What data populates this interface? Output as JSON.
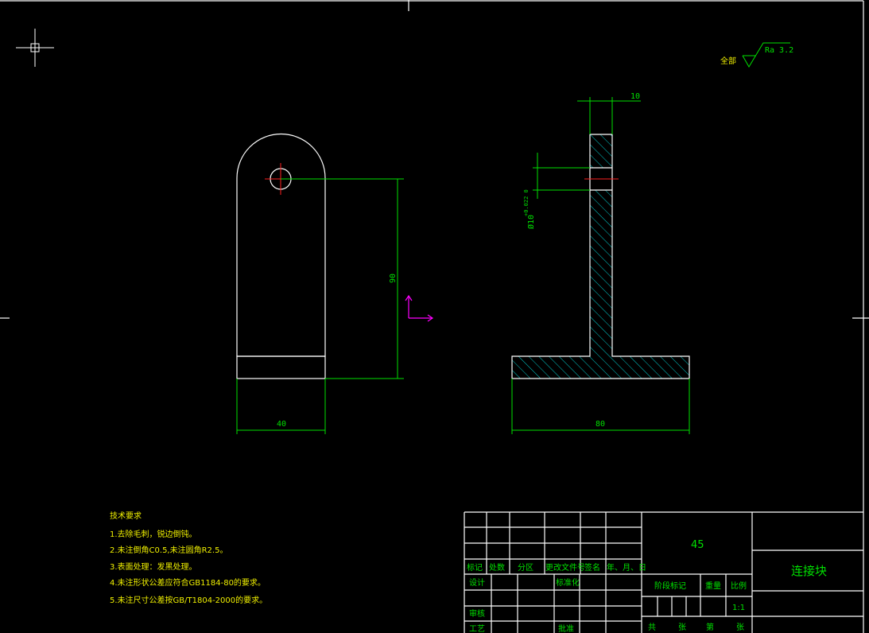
{
  "surface_finish": {
    "prefix": "全部",
    "value": "Ra 3.2"
  },
  "dimensions": {
    "front_width": "40",
    "front_height": "90",
    "side_width": "80",
    "side_thickness": "10",
    "hole_diameter": "Ø10",
    "hole_tolerance": "+0.022 0"
  },
  "tech_requirements": {
    "title": "技术要求",
    "items": [
      "1.去除毛刺，锐边倒钝。",
      "2.未注倒角C0.5,未注圆角R2.5。",
      "3.表面处理：发黑处理。",
      "4.未注形状公差应符合GB1184-80的要求。",
      "5.未注尺寸公差按GB/T1804-2000的要求。"
    ]
  },
  "title_block": {
    "material": "45",
    "part_name": "连接块",
    "rev_headers": [
      "标记",
      "处数",
      "分区",
      "更改文件号",
      "签名",
      "年、月、日"
    ],
    "roles": [
      "设计",
      "审核",
      "工艺"
    ],
    "standardization": "标准化",
    "approve": "批准",
    "stage_mark": "阶段标记",
    "weight": "重量",
    "scale": "比例",
    "scale_value": "1:1",
    "sheet_total": "共",
    "sheet_unit": "张",
    "sheet_no": "第",
    "sheet_unit2": "张"
  },
  "colors": {
    "outline": "#ffffff",
    "dimension": "#00e000",
    "center": "#ff2020",
    "ucs": "#ff00ff",
    "hatch": "#00c8c8"
  }
}
